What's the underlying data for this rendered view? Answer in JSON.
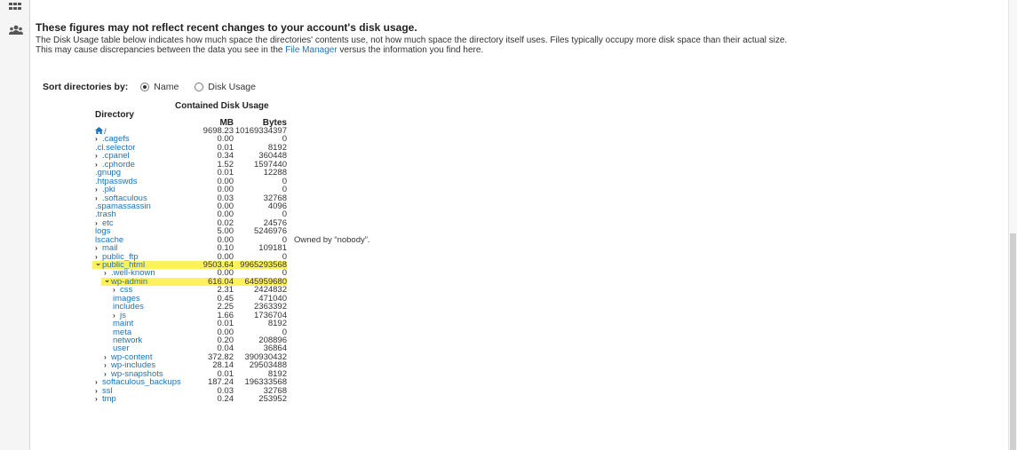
{
  "notice": {
    "title": "These figures may not reflect recent changes to your account's disk usage.",
    "body_before": "The Disk Usage table below indicates how much space the directories' contents use, not how much space the directory itself uses. Files typically occupy more disk space than their actual size. This may cause discrepancies between the data you see in the ",
    "link_text": "File Manager",
    "body_after": " versus the information you find here."
  },
  "sort": {
    "label": "Sort directories by:",
    "options": [
      {
        "label": "Name",
        "selected": true
      },
      {
        "label": "Disk Usage",
        "selected": false
      }
    ]
  },
  "table": {
    "directory_header": "Directory",
    "group_header": "Contained Disk Usage",
    "mb_header": "MB",
    "bytes_header": "Bytes",
    "highlight_color": "#fdf25c",
    "rows": [
      {
        "name": "/",
        "level": 0,
        "chevron": "",
        "home": true,
        "mb": "9698.23",
        "bytes": "10169334397",
        "note": ""
      },
      {
        "name": ".cagefs",
        "level": 0,
        "chevron": "right",
        "mb": "0.00",
        "bytes": "0",
        "note": ""
      },
      {
        "name": ".cl.selector",
        "level": 0,
        "chevron": "",
        "mb": "0.01",
        "bytes": "8192",
        "note": ""
      },
      {
        "name": ".cpanel",
        "level": 0,
        "chevron": "right",
        "mb": "0.34",
        "bytes": "360448",
        "note": ""
      },
      {
        "name": ".cphorde",
        "level": 0,
        "chevron": "right",
        "mb": "1.52",
        "bytes": "1597440",
        "note": ""
      },
      {
        "name": ".gnupg",
        "level": 0,
        "chevron": "",
        "mb": "0.01",
        "bytes": "12288",
        "note": ""
      },
      {
        "name": ".htpasswds",
        "level": 0,
        "chevron": "",
        "mb": "0.00",
        "bytes": "0",
        "note": ""
      },
      {
        "name": ".pki",
        "level": 0,
        "chevron": "right",
        "mb": "0.00",
        "bytes": "0",
        "note": ""
      },
      {
        "name": ".softaculous",
        "level": 0,
        "chevron": "right",
        "mb": "0.03",
        "bytes": "32768",
        "note": ""
      },
      {
        "name": ".spamassassin",
        "level": 0,
        "chevron": "",
        "mb": "0.00",
        "bytes": "4096",
        "note": ""
      },
      {
        "name": ".trash",
        "level": 0,
        "chevron": "",
        "mb": "0.00",
        "bytes": "0",
        "note": ""
      },
      {
        "name": "etc",
        "level": 0,
        "chevron": "right",
        "mb": "0.02",
        "bytes": "24576",
        "note": ""
      },
      {
        "name": "logs",
        "level": 0,
        "chevron": "",
        "mb": "5.00",
        "bytes": "5246976",
        "note": ""
      },
      {
        "name": "lscache",
        "level": 0,
        "chevron": "",
        "mb": "0.00",
        "bytes": "0",
        "note": "Owned by “nobody”."
      },
      {
        "name": "mail",
        "level": 0,
        "chevron": "right",
        "mb": "0.10",
        "bytes": "109181",
        "note": ""
      },
      {
        "name": "public_ftp",
        "level": 0,
        "chevron": "right",
        "mb": "0.00",
        "bytes": "0",
        "note": ""
      },
      {
        "name": "public_html",
        "level": 0,
        "chevron": "down",
        "highlight": true,
        "mb": "9503.64",
        "bytes": "9965293568",
        "note": ""
      },
      {
        "name": ".well-known",
        "level": 1,
        "chevron": "right",
        "mb": "0.00",
        "bytes": "0",
        "note": ""
      },
      {
        "name": "wp-admin",
        "level": 1,
        "chevron": "down",
        "highlight": true,
        "mb": "616.04",
        "bytes": "645959680",
        "note": ""
      },
      {
        "name": "css",
        "level": 2,
        "chevron": "right",
        "mb": "2.31",
        "bytes": "2424832",
        "note": ""
      },
      {
        "name": "images",
        "level": 2,
        "chevron": "",
        "mb": "0.45",
        "bytes": "471040",
        "note": ""
      },
      {
        "name": "includes",
        "level": 2,
        "chevron": "",
        "mb": "2.25",
        "bytes": "2363392",
        "note": ""
      },
      {
        "name": "js",
        "level": 2,
        "chevron": "right",
        "mb": "1.66",
        "bytes": "1736704",
        "note": ""
      },
      {
        "name": "maint",
        "level": 2,
        "chevron": "",
        "mb": "0.01",
        "bytes": "8192",
        "note": ""
      },
      {
        "name": "meta",
        "level": 2,
        "chevron": "",
        "mb": "0.00",
        "bytes": "0",
        "note": ""
      },
      {
        "name": "network",
        "level": 2,
        "chevron": "",
        "mb": "0.20",
        "bytes": "208896",
        "note": ""
      },
      {
        "name": "user",
        "level": 2,
        "chevron": "",
        "mb": "0.04",
        "bytes": "36864",
        "note": ""
      },
      {
        "name": "wp-content",
        "level": 1,
        "chevron": "right",
        "mb": "372.82",
        "bytes": "390930432",
        "note": ""
      },
      {
        "name": "wp-includes",
        "level": 1,
        "chevron": "right",
        "mb": "28.14",
        "bytes": "29503488",
        "note": ""
      },
      {
        "name": "wp-snapshots",
        "level": 1,
        "chevron": "right",
        "mb": "0.01",
        "bytes": "8192",
        "note": ""
      },
      {
        "name": "softaculous_backups",
        "level": 0,
        "chevron": "right",
        "mb": "187.24",
        "bytes": "196333568",
        "note": ""
      },
      {
        "name": "ssl",
        "level": 0,
        "chevron": "right",
        "mb": "0.03",
        "bytes": "32768",
        "note": ""
      },
      {
        "name": "tmp",
        "level": 0,
        "chevron": "right",
        "mb": "0.24",
        "bytes": "253952",
        "note": ""
      }
    ]
  },
  "icons": {
    "rail_top": "grid-icon",
    "rail_second": "users-icon",
    "home": "home-icon",
    "expand": "chevron-right-icon",
    "collapse": "chevron-down-icon"
  }
}
